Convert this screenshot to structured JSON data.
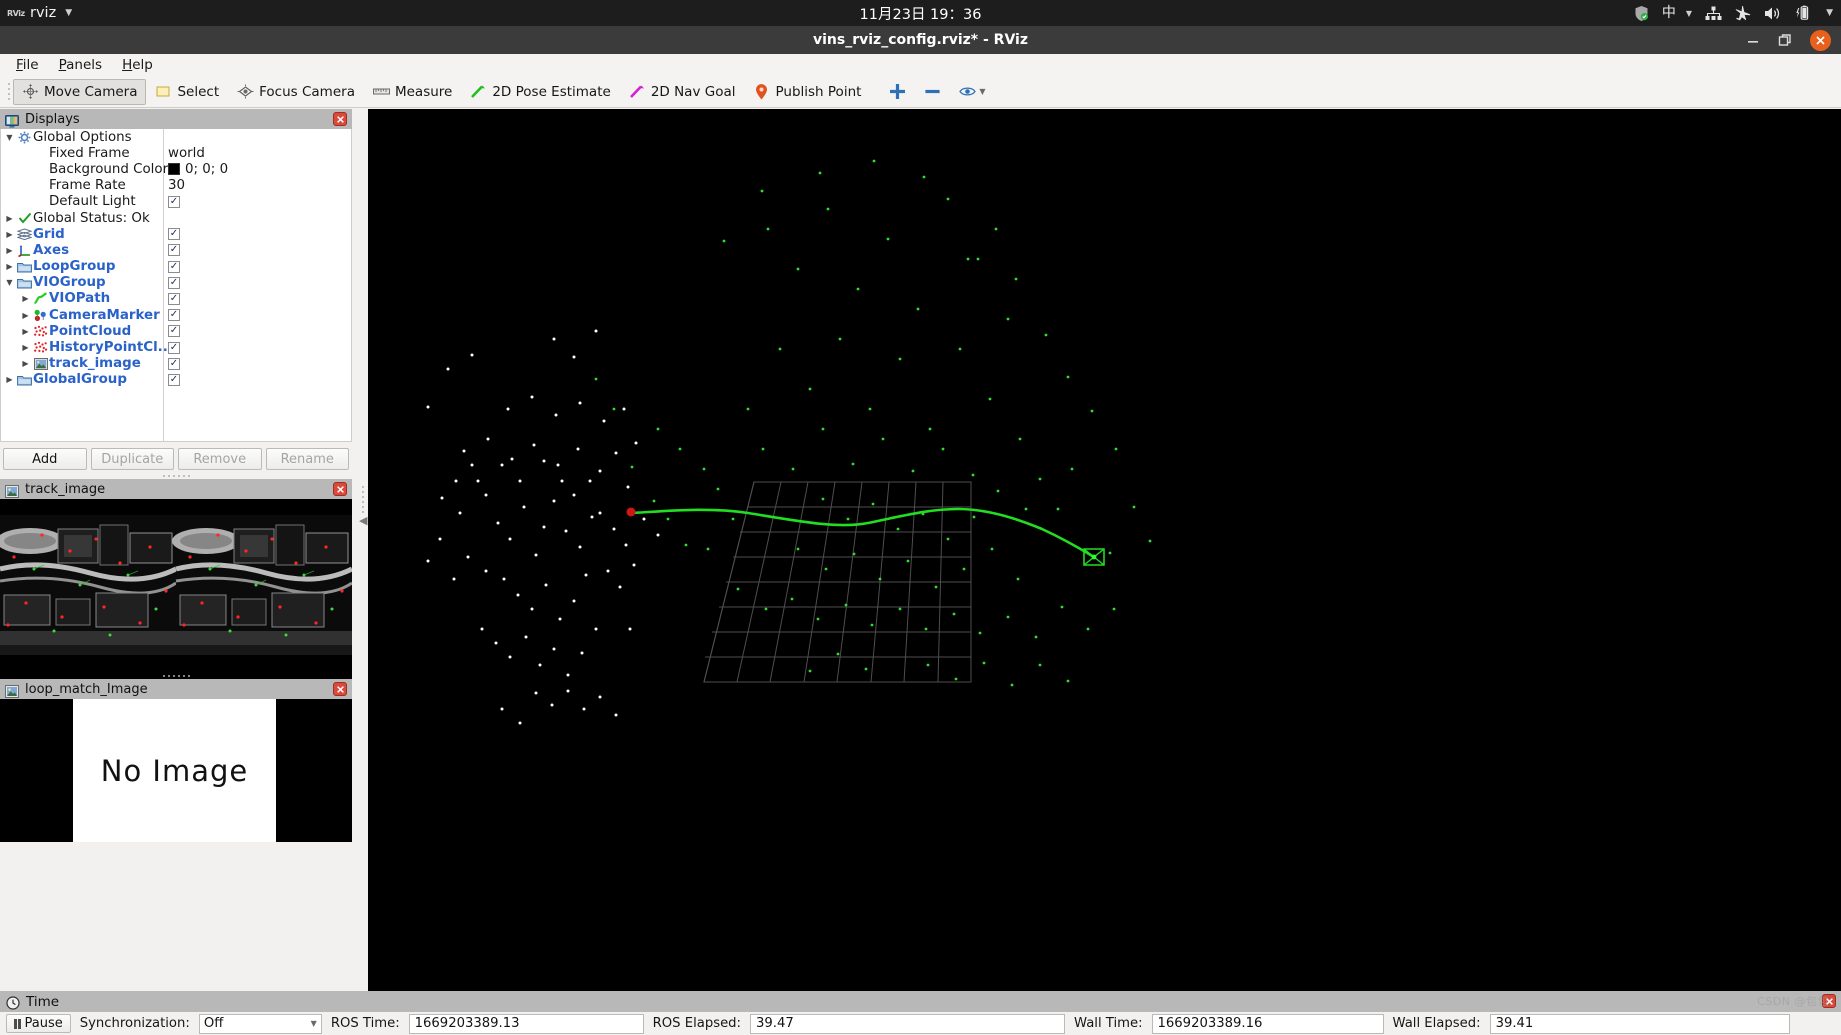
{
  "system_bar": {
    "app_icon": "rviz-app-icon",
    "app_name": "rviz",
    "clock": "11月23日  19：36",
    "tray": [
      {
        "name": "shield-check-icon"
      },
      {
        "name": "input-method-icon",
        "label": "中"
      },
      {
        "name": "network-icon"
      },
      {
        "name": "airplane-mode-icon"
      },
      {
        "name": "volume-icon"
      },
      {
        "name": "battery-icon"
      }
    ]
  },
  "window": {
    "title": "vins_rviz_config.rviz* - RViz",
    "minimize": "—",
    "restore": "❐",
    "close": "✕"
  },
  "menubar": [
    {
      "label": "File",
      "mnemonic": "F"
    },
    {
      "label": "Panels",
      "mnemonic": "P"
    },
    {
      "label": "Help",
      "mnemonic": "H"
    }
  ],
  "toolbar": {
    "buttons": [
      {
        "label": "Move Camera",
        "icon": "move-camera-icon",
        "active": true
      },
      {
        "label": "Select",
        "icon": "select-icon",
        "active": false
      },
      {
        "label": "Focus Camera",
        "icon": "focus-camera-icon",
        "active": false
      },
      {
        "label": "Measure",
        "icon": "measure-icon",
        "active": false
      },
      {
        "label": "2D Pose Estimate",
        "icon": "pose-estimate-icon",
        "active": false
      },
      {
        "label": "2D Nav Goal",
        "icon": "nav-goal-icon",
        "active": false
      },
      {
        "label": "Publish Point",
        "icon": "publish-point-icon",
        "active": false
      }
    ],
    "extra_icons": [
      {
        "name": "add-tool-icon"
      },
      {
        "name": "remove-tool-icon"
      },
      {
        "name": "eye-tool-icon"
      }
    ]
  },
  "displays_panel": {
    "title": "Displays",
    "icon": "displays-panel-icon",
    "close": "✕",
    "tree": [
      {
        "arrow": "down",
        "icon": "gear-icon",
        "label": "Global Options",
        "blue": false,
        "indent": 0,
        "value_type": "none"
      },
      {
        "arrow": "none",
        "icon": "none",
        "label": "Fixed Frame",
        "blue": false,
        "indent": 1,
        "value_type": "text",
        "value": "world"
      },
      {
        "arrow": "none",
        "icon": "none",
        "label": "Background Color",
        "blue": false,
        "indent": 1,
        "value_type": "color",
        "value": "0; 0; 0"
      },
      {
        "arrow": "none",
        "icon": "none",
        "label": "Frame Rate",
        "blue": false,
        "indent": 1,
        "value_type": "text",
        "value": "30"
      },
      {
        "arrow": "none",
        "icon": "none",
        "label": "Default Light",
        "blue": false,
        "indent": 1,
        "value_type": "check",
        "value": "✓"
      },
      {
        "arrow": "right",
        "icon": "check-icon",
        "label": "Global Status: Ok",
        "blue": false,
        "indent": 0,
        "value_type": "none"
      },
      {
        "arrow": "right",
        "icon": "grid-icon",
        "label": "Grid",
        "blue": true,
        "indent": 0,
        "value_type": "check",
        "value": "✓"
      },
      {
        "arrow": "right",
        "icon": "axes-icon",
        "label": "Axes",
        "blue": true,
        "indent": 0,
        "value_type": "check",
        "value": "✓"
      },
      {
        "arrow": "right",
        "icon": "folder-icon",
        "label": "LoopGroup",
        "blue": true,
        "indent": 0,
        "value_type": "check",
        "value": "✓"
      },
      {
        "arrow": "down",
        "icon": "folder-icon",
        "label": "VIOGroup",
        "blue": true,
        "indent": 0,
        "value_type": "check",
        "value": "✓"
      },
      {
        "arrow": "right",
        "icon": "path-icon",
        "label": "VIOPath",
        "blue": true,
        "indent": 1,
        "value_type": "check",
        "value": "✓"
      },
      {
        "arrow": "right",
        "icon": "marker-icon",
        "label": "CameraMarker",
        "blue": true,
        "indent": 1,
        "value_type": "check",
        "value": "✓"
      },
      {
        "arrow": "right",
        "icon": "pointcloud-icon",
        "label": "PointCloud",
        "blue": true,
        "indent": 1,
        "value_type": "check",
        "value": "✓"
      },
      {
        "arrow": "right",
        "icon": "pointcloud-icon",
        "label": "HistoryPointCl...",
        "blue": true,
        "indent": 1,
        "value_type": "check",
        "value": "✓"
      },
      {
        "arrow": "right",
        "icon": "image-icon",
        "label": "track_image",
        "blue": true,
        "indent": 1,
        "value_type": "check",
        "value": "✓"
      },
      {
        "arrow": "right",
        "icon": "folder-icon",
        "label": "GlobalGroup",
        "blue": true,
        "indent": 0,
        "value_type": "check",
        "value": "✓"
      }
    ],
    "buttons": [
      {
        "label": "Add",
        "enabled": true
      },
      {
        "label": "Duplicate",
        "enabled": false
      },
      {
        "label": "Remove",
        "enabled": false
      },
      {
        "label": "Rename",
        "enabled": false
      }
    ]
  },
  "track_image_panel": {
    "title": "track_image",
    "icon": "image-panel-icon",
    "close": "✕"
  },
  "loop_match_panel": {
    "title": "loop_match_Image",
    "icon": "image-panel-icon",
    "close": "✕",
    "placeholder": "No Image"
  },
  "time_panel": {
    "title": "Time",
    "icon": "clock-icon",
    "close": "✕",
    "pause_label": "Pause",
    "sync_label": "Synchronization:",
    "sync_value": "Off",
    "fields": [
      {
        "label": "ROS Time:",
        "value": "1669203389.13"
      },
      {
        "label": "ROS Elapsed:",
        "value": "39.47"
      },
      {
        "label": "Wall Time:",
        "value": "1669203389.16"
      },
      {
        "label": "Wall Elapsed:",
        "value": "39.41"
      }
    ]
  },
  "viewport": {
    "background_color": "#000000",
    "grid_color": "#5a5a5a",
    "trajectory_color": "#22dd22",
    "pointcloud_color": "#ffffff",
    "history_point_color": "#2ecc2e",
    "marker_color": "#ff2020"
  },
  "watermark": "CSDN @包包"
}
